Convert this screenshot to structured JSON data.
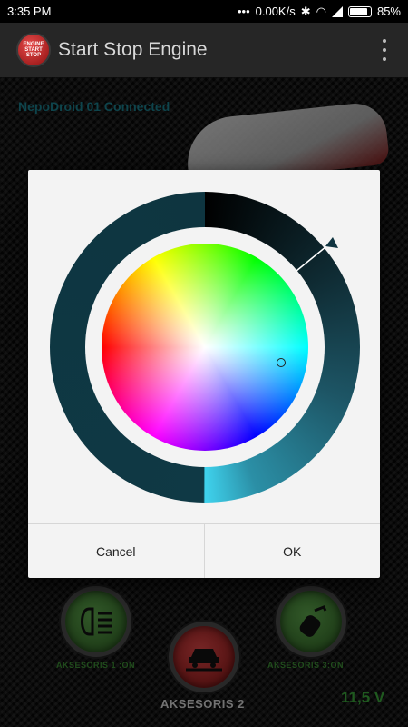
{
  "status_bar": {
    "time": "3:35 PM",
    "network_speed": "0.00K/s",
    "battery": "85%"
  },
  "app_bar": {
    "title": "Start Stop Engine",
    "logo_text": "ENGINE START STOP"
  },
  "connection_status": "NepoDroid 01 Connected",
  "bottom_controls": {
    "button1_label": "AKSESORIS 1 :ON",
    "button2_label": "AKSESORIS 2",
    "button3_label": "AKSESORIS 3:ON",
    "voltage": "11,5 V"
  },
  "color_picker": {
    "cancel_label": "Cancel",
    "ok_label": "OK",
    "accent_color": "#3fd3ee"
  }
}
